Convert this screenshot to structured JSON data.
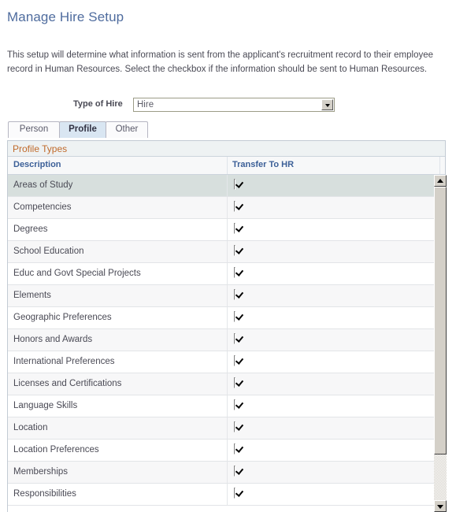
{
  "page": {
    "title": "Manage Hire Setup",
    "intro": "This setup will determine what information is sent from the applicant's recruitment record to their employee record in Human Resources. Select the checkbox if the information should be sent to Human Resources."
  },
  "form": {
    "hire_type_label": "Type of Hire",
    "hire_type_value": "Hire",
    "hire_type_options": [
      "Hire"
    ],
    "dropdown_icon": "chevron-down-icon"
  },
  "tabs": [
    {
      "label": "Person",
      "active": false
    },
    {
      "label": "Profile",
      "active": true
    },
    {
      "label": "Other",
      "active": false
    }
  ],
  "grid": {
    "caption": "Profile Types",
    "columns": [
      "Description",
      "Transfer To HR"
    ],
    "rows": [
      {
        "description": "Areas of Study",
        "transfer_to_hr": true,
        "selected": true
      },
      {
        "description": "Competencies",
        "transfer_to_hr": true,
        "selected": false
      },
      {
        "description": "Degrees",
        "transfer_to_hr": true,
        "selected": false
      },
      {
        "description": "School Education",
        "transfer_to_hr": true,
        "selected": false
      },
      {
        "description": "Educ and Govt Special Projects",
        "transfer_to_hr": true,
        "selected": false
      },
      {
        "description": "Elements",
        "transfer_to_hr": true,
        "selected": false
      },
      {
        "description": "Geographic Preferences",
        "transfer_to_hr": true,
        "selected": false
      },
      {
        "description": "Honors and Awards",
        "transfer_to_hr": true,
        "selected": false
      },
      {
        "description": "International Preferences",
        "transfer_to_hr": true,
        "selected": false
      },
      {
        "description": "Licenses and Certifications",
        "transfer_to_hr": true,
        "selected": false
      },
      {
        "description": "Language Skills",
        "transfer_to_hr": true,
        "selected": false
      },
      {
        "description": "Location",
        "transfer_to_hr": true,
        "selected": false
      },
      {
        "description": "Location Preferences",
        "transfer_to_hr": true,
        "selected": false
      },
      {
        "description": "Memberships",
        "transfer_to_hr": true,
        "selected": false
      },
      {
        "description": "Responsibilities",
        "transfer_to_hr": true,
        "selected": false
      }
    ]
  },
  "scrollbar": {
    "up_icon": "triangle-up-icon",
    "down_icon": "triangle-down-icon"
  },
  "colors": {
    "title": "#4f6c9e",
    "caption": "#c06a2b",
    "column_header": "#3c6098",
    "selected_row": "#d7dfdd",
    "active_tab": "#d9e6f2"
  }
}
